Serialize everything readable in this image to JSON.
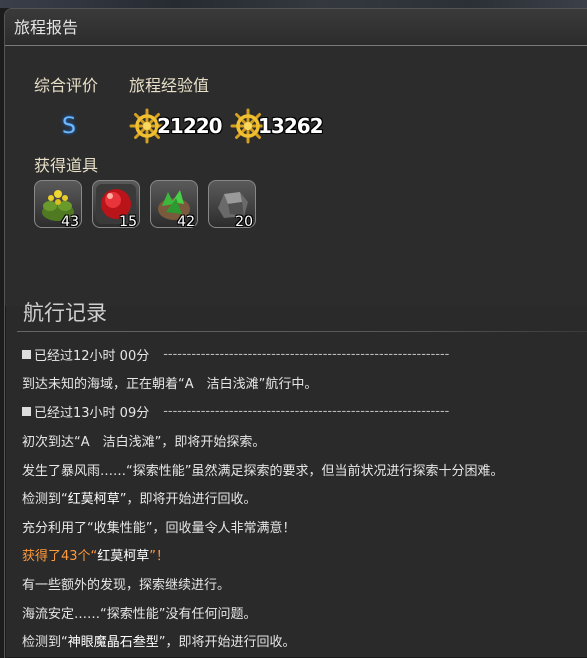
{
  "window": {
    "title": "旅程报告"
  },
  "summary": {
    "rating_label": "综合评价",
    "exp_label": "旅程经验值",
    "rating_value": "S",
    "exp_values": [
      "21220",
      "13262"
    ],
    "exp_icon": "ship-wheel-icon"
  },
  "items": {
    "label": "获得道具",
    "list": [
      {
        "icon": "herb-plant-icon",
        "count": "43"
      },
      {
        "icon": "red-gem-icon",
        "count": "15"
      },
      {
        "icon": "green-crystal-ore-icon",
        "count": "42"
      },
      {
        "icon": "gray-stone-icon",
        "count": "20"
      }
    ]
  },
  "log": {
    "title": "航行记录",
    "entries": [
      {
        "type": "header",
        "text": "已经过12小时 00分"
      },
      {
        "type": "text",
        "parts": [
          "到达未知的海域，正在朝着“A　洁白浅滩”航行中。"
        ]
      },
      {
        "type": "header",
        "text": "已经过13小时 09分"
      },
      {
        "type": "text",
        "parts": [
          "初次到达“A　洁白浅滩”，即将开始探索。"
        ]
      },
      {
        "type": "text",
        "parts": [
          "发生了暴风雨……“探索性能”虽然满足探索的要求，但当前状况进行探索十分困难。"
        ]
      },
      {
        "type": "text",
        "parts": [
          "检测到“",
          "红莫柯草",
          "”，即将开始进行回收。"
        ]
      },
      {
        "type": "text",
        "parts": [
          "充分利用了“收集性能”，回收量令人非常满意！"
        ]
      },
      {
        "type": "highlight",
        "parts": [
          "获得了43个“",
          "红莫柯草",
          "”！"
        ]
      },
      {
        "type": "text",
        "parts": [
          "有一些额外的发现，探索继续进行。"
        ]
      },
      {
        "type": "text",
        "parts": [
          "海流安定……“探索性能”没有任何问题。"
        ]
      },
      {
        "type": "text",
        "parts": [
          "检测到“",
          "神眼魔晶石叁型",
          "”，即将开始进行回收。"
        ]
      }
    ],
    "dashes": "-------------------------------------------------------------"
  },
  "colors": {
    "rating": "#6fb8ff",
    "highlight": "#ff9a3c",
    "label": "#e8e0c8"
  }
}
